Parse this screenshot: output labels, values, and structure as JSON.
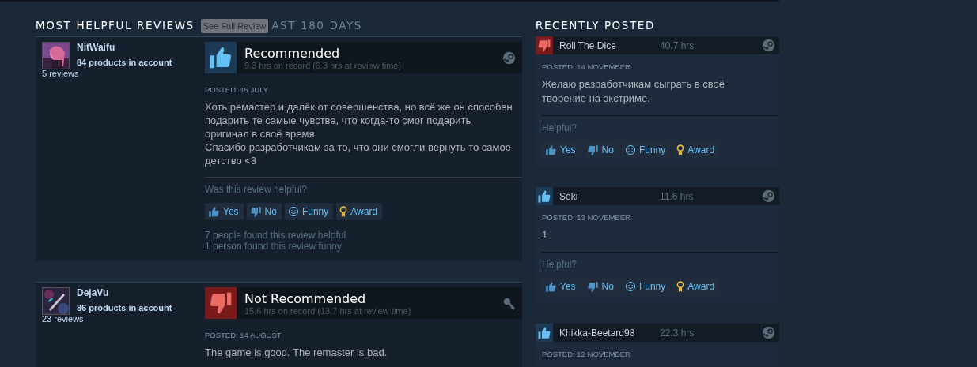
{
  "helpful_section": {
    "title": "MOST HELPFUL REVIEWS",
    "tooltip": "See Full Review",
    "subtitle": "AST 180 DAYS",
    "reviews": [
      {
        "author": "NitWaifu",
        "products": "84 products in account",
        "review_count": "5 reviews",
        "recommended": true,
        "verdict": "Recommended",
        "hours": "9.3 hrs on record (6.3 hrs at review time)",
        "steam_purchase": true,
        "posted": "POSTED: 15 JULY",
        "body": "Хоть ремастер и далёк от совершенства, но всё же он способен подарить те самые чувства, что когда-то смог подарить оригинал в своё время.\nСпасибо разработчикам за то, что они смогли вернуть то самое детство <3",
        "prompt": "Was this review helpful?",
        "buttons": [
          {
            "kind": "yes",
            "label": "Yes"
          },
          {
            "kind": "no",
            "label": "No"
          },
          {
            "kind": "funny",
            "label": "Funny"
          },
          {
            "kind": "award",
            "label": "Award"
          }
        ],
        "counts": [
          "7 people found this review helpful",
          "1 person found this review funny"
        ]
      },
      {
        "author": "DejaVu",
        "products": "86 products in account",
        "review_count": "23 reviews",
        "recommended": false,
        "verdict": "Not Recommended",
        "hours": "15.6 hrs on record (13.7 hrs at review time)",
        "steam_purchase": false,
        "posted": "POSTED: 14 AUGUST",
        "body": "The game is good. The remaster is bad."
      }
    ]
  },
  "recent_section": {
    "title": "RECENTLY POSTED",
    "reviews": [
      {
        "author": "Roll The Dice",
        "hours": "40.7 hrs",
        "recommended": false,
        "posted": "POSTED: 14 NOVEMBER",
        "body": "Желаю разработчикам сыграть в своё творение на экстриме.",
        "prompt": "Helpful?",
        "buttons": [
          {
            "kind": "yes",
            "label": "Yes"
          },
          {
            "kind": "no",
            "label": "No"
          },
          {
            "kind": "funny",
            "label": "Funny"
          },
          {
            "kind": "award",
            "label": "Award"
          }
        ]
      },
      {
        "author": "Seki",
        "hours": "11.6 hrs",
        "recommended": true,
        "posted": "POSTED: 13 NOVEMBER",
        "body": "1",
        "prompt": "Helpful?",
        "buttons": [
          {
            "kind": "yes",
            "label": "Yes"
          },
          {
            "kind": "no",
            "label": "No"
          },
          {
            "kind": "funny",
            "label": "Funny"
          },
          {
            "kind": "award",
            "label": "Award"
          }
        ]
      },
      {
        "author": "Khikka-Beetard98",
        "hours": "22.3 hrs",
        "recommended": true,
        "posted": "POSTED: 12 NOVEMBER"
      }
    ]
  }
}
